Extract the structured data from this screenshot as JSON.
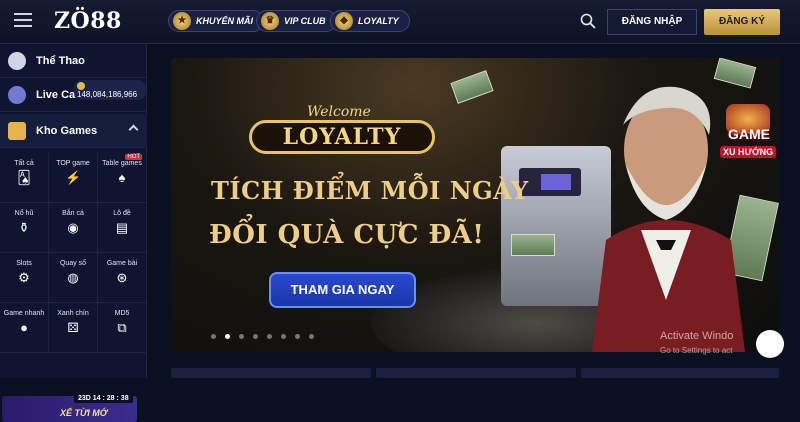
{
  "header": {
    "logo_text": "ZÖ88",
    "promo_label": "KHUYẾN MÃI",
    "vip_label": "VIP CLUB",
    "loyalty_label": "LOYALTY",
    "login_label": "ĐĂNG NHẬP",
    "signup_label": "ĐĂNG KÝ"
  },
  "sidebar": {
    "sports": "Thể Thao",
    "jackpot": "148,084,186,966",
    "live_casino": "Live Casino",
    "games": "Kho Games",
    "grid": [
      {
        "label": "Tất cả",
        "icon": "cards-icon"
      },
      {
        "label": "TOP game",
        "icon": "lightning-icon"
      },
      {
        "label": "Table games",
        "icon": "table-cards-icon",
        "badge": "HOT"
      },
      {
        "label": "Nổ hũ",
        "icon": "jar-icon"
      },
      {
        "label": "Bắn cá",
        "icon": "fish-icon"
      },
      {
        "label": "Lô đề",
        "icon": "lottery-ticket-icon"
      },
      {
        "label": "Slots",
        "icon": "slot-icon"
      },
      {
        "label": "Quay số",
        "icon": "lottery-ball-icon"
      },
      {
        "label": "Game bài",
        "icon": "chip-icon"
      },
      {
        "label": "Game nhanh",
        "icon": "bomb-icon"
      },
      {
        "label": "Xanh chín",
        "icon": "dice-icon"
      },
      {
        "label": "MD5",
        "icon": "md5-icon"
      }
    ],
    "promo_timer": "23D 14 : 28 : 38",
    "promo_title": "XẾ TỪI MỚ"
  },
  "banner": {
    "welcome": "Welcome",
    "loyalty": "LOYALTY",
    "headline_1": "TÍCH ĐIỂM MỖI NGÀY",
    "headline_2": "ĐỔI QUÀ CỰC ĐÃ!",
    "cta": "THAM GIA NGAY",
    "active_slide": 1,
    "slides": 8
  },
  "side_badge": {
    "title": "GAME",
    "subtitle": "XU HƯỚNG"
  },
  "watermark": {
    "line1": "Activate Windo",
    "line2": "Go to Settings to act"
  },
  "colors": {
    "accent_gold": "#efcd86",
    "cta_blue": "#1836a8",
    "bg_dark": "#0b1020"
  }
}
